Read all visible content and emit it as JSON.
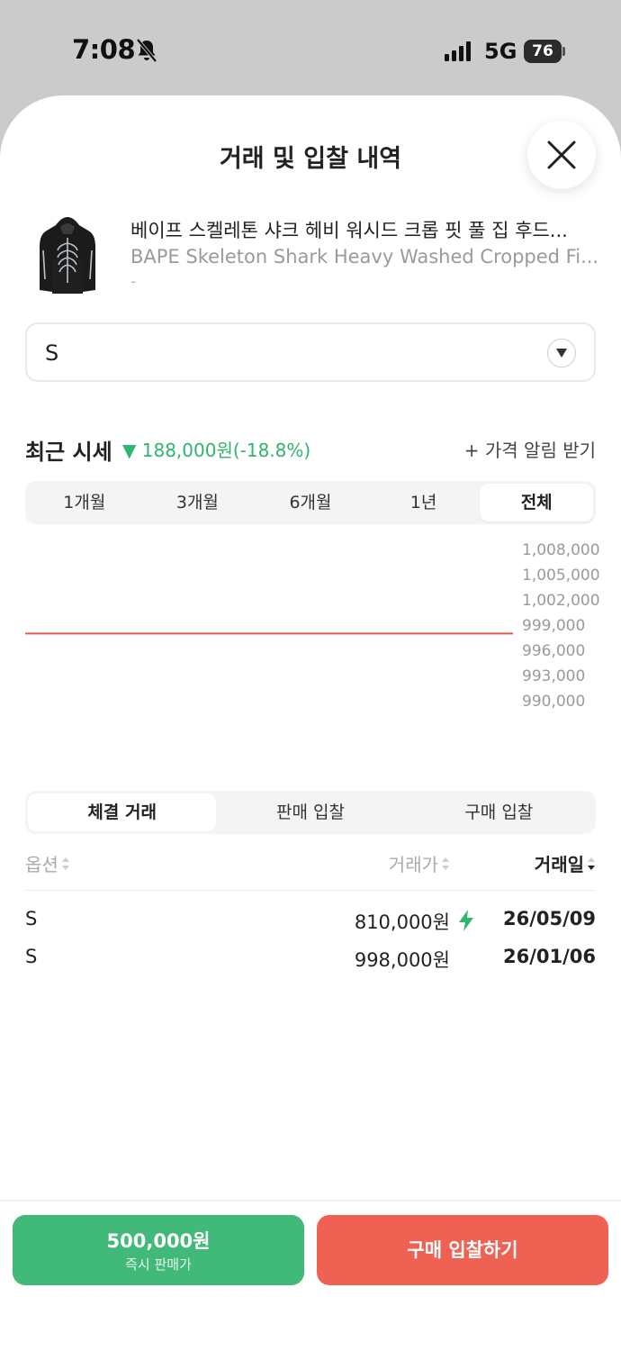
{
  "status_bar": {
    "time": "7:08",
    "network": "5G",
    "battery": "76"
  },
  "sheet": {
    "title": "거래 및 입찰 내역"
  },
  "product": {
    "name_ko": "베이프 스켈레톤 샤크 헤비 워시드 크롭 핏 풀 집 후드...",
    "name_en": "BAPE Skeleton Shark Heavy Washed Cropped Fi...",
    "sub": "-"
  },
  "size_select": {
    "value": "S"
  },
  "recent": {
    "label": "최근 시세",
    "change": "▼ 188,000원(-18.8%)",
    "alert": "+ 가격 알림 받기",
    "change_color": "#31b46e"
  },
  "period_tabs": [
    "1개월",
    "3개월",
    "6개월",
    "1년",
    "전체"
  ],
  "period_active": "전체",
  "chart_data": {
    "type": "line",
    "ylim": [
      990000,
      1008000
    ],
    "y_ticks": [
      "1,008,000",
      "1,005,000",
      "1,002,000",
      "999,000",
      "996,000",
      "993,000",
      "990,000"
    ],
    "y_tick_values": [
      1008000,
      1005000,
      1002000,
      999000,
      996000,
      993000,
      990000
    ],
    "series": [
      {
        "values": [
          998000,
          998000
        ],
        "color": "#e8584b"
      }
    ]
  },
  "trade_tabs": [
    "체결 거래",
    "판매 입찰",
    "구매 입찰"
  ],
  "trade_active": "체결 거래",
  "table": {
    "headers": {
      "option": "옵션",
      "price": "거래가",
      "date": "거래일"
    },
    "rows": [
      {
        "option": "S",
        "price": "810,000원",
        "bolt": true,
        "date": "26/05/09"
      },
      {
        "option": "S",
        "price": "998,000원",
        "bolt": false,
        "date": "26/01/06"
      }
    ]
  },
  "bottom": {
    "sell_price": "500,000원",
    "sell_label": "즉시 판매가",
    "buy_label": "구매 입찰하기",
    "sell_color": "#41b979",
    "buy_color": "#ef6253"
  }
}
